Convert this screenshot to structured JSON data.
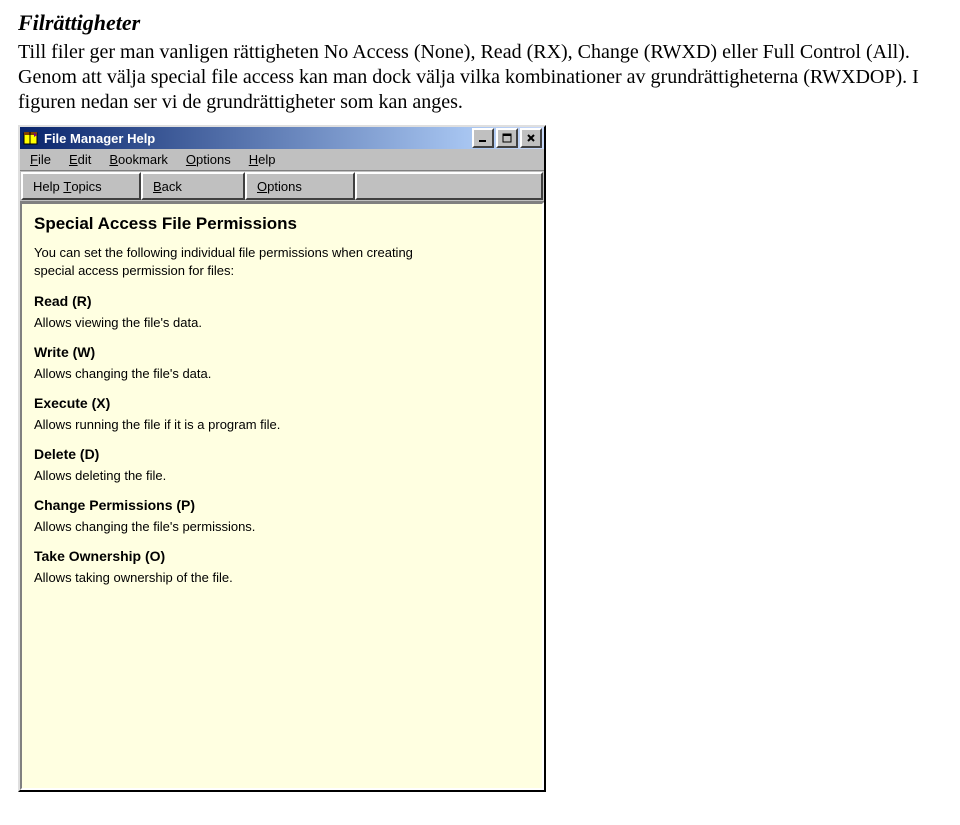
{
  "doc": {
    "heading": "Filrättigheter",
    "para1": "Till filer ger man vanligen rättigheten No Access (None), Read (RX), Change (RWXD) eller Full Control (All). Genom att välja special file access kan man dock välja vilka kombinationer av grundrättigheterna (RWXDOP). I figuren nedan ser vi de grundrättigheter som kan anges."
  },
  "window": {
    "title": "File Manager Help",
    "menus": {
      "file": "File",
      "edit": "Edit",
      "bookmark": "Bookmark",
      "options": "Options",
      "help": "Help"
    },
    "toolbar": {
      "help_topics": "Help Topics",
      "back": "Back",
      "options": "Options"
    },
    "help": {
      "heading": "Special Access File Permissions",
      "intro": "You can set the following individual file permissions when creating special access permission for files:",
      "perms": [
        {
          "title": "Read (R)",
          "desc": "Allows viewing the file's data."
        },
        {
          "title": "Write (W)",
          "desc": "Allows changing the file's data."
        },
        {
          "title": "Execute (X)",
          "desc": "Allows running the file if it is a program file."
        },
        {
          "title": "Delete (D)",
          "desc": "Allows deleting the file."
        },
        {
          "title": "Change Permissions (P)",
          "desc": "Allows changing the file's permissions."
        },
        {
          "title": "Take Ownership (O)",
          "desc": "Allows taking ownership of the file."
        }
      ]
    }
  }
}
